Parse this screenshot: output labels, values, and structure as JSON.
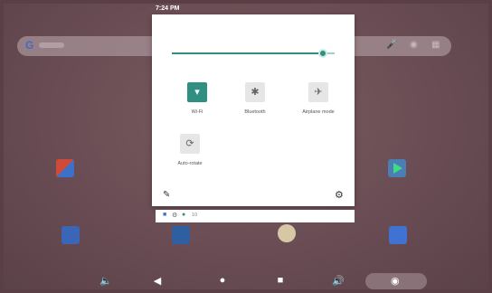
{
  "status_bar": {
    "time": "7:24 PM"
  },
  "search": {
    "logo_letter": "G",
    "mic_icon": "mic-icon",
    "lens_icon": "lens-icon",
    "apps_icon": "app-grid-icon"
  },
  "quick_settings": {
    "brightness_level": 0.93,
    "tiles": [
      {
        "label": "Wi-Fi",
        "icon": "wifi-icon",
        "active": true
      },
      {
        "label": "Bluetooth",
        "icon": "bluetooth-icon",
        "active": false
      },
      {
        "label": "Airplane mode",
        "icon": "airplane-icon",
        "active": false
      },
      {
        "label": "Auto-rotate",
        "icon": "auto-rotate-icon",
        "active": false
      }
    ],
    "edit_icon": "pencil-icon",
    "settings_icon": "gear-icon"
  },
  "notification_strip": {
    "extra_text": "10"
  },
  "nav_bar": {
    "buttons": [
      "volume-down-icon",
      "back-icon",
      "home-icon",
      "recents-icon",
      "volume-up-icon",
      "camera-icon"
    ]
  },
  "colors": {
    "accent": "#2f8f83",
    "wallpaper": "#6d4f56",
    "panel": "#ffffff"
  }
}
